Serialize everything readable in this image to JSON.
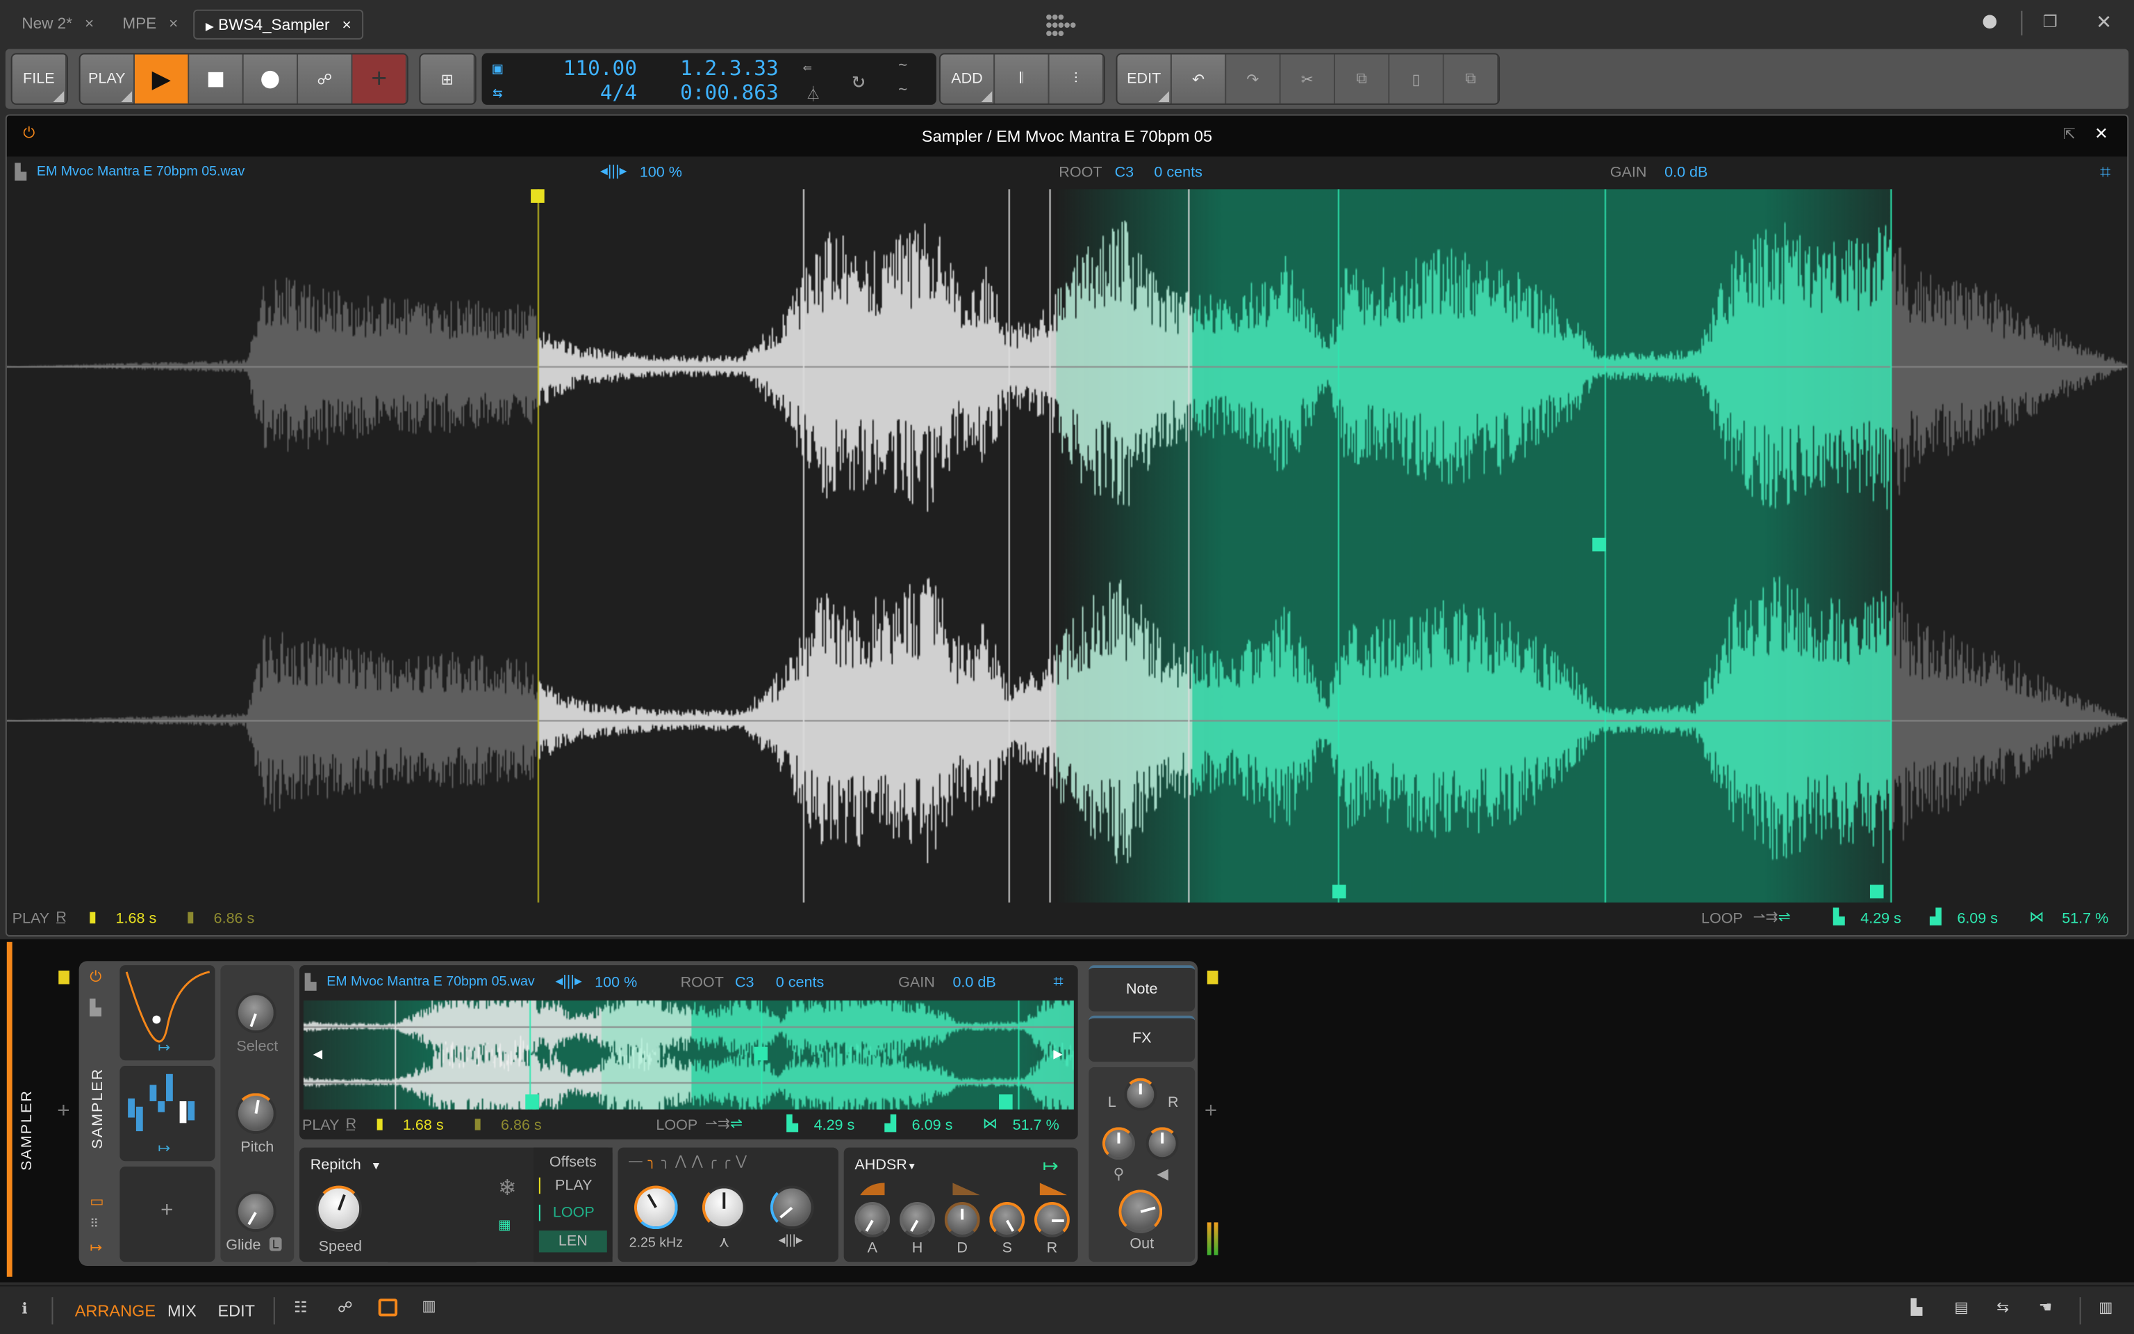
{
  "tabs": [
    {
      "label": "New 2*"
    },
    {
      "label": "MPE"
    },
    {
      "label": "BWS4_Sampler",
      "active": true
    }
  ],
  "tab_close": "×",
  "toolbar": {
    "file": "FILE",
    "play": "PLAY",
    "add": "ADD",
    "edit": "EDIT",
    "tempo": "110.00",
    "signature": "4/4",
    "position": "1.2.3.33",
    "time": "0:00.863"
  },
  "editor": {
    "title": "Sampler / EM Mvoc Mantra E 70bpm 05",
    "filename": "EM Mvoc Mantra E 70bpm 05.wav",
    "speed": "100 %",
    "root_label": "ROOT",
    "root": "C3",
    "cents": "0 cents",
    "gain_label": "GAIN",
    "gain": "0.0 dB",
    "play_label": "PLAY",
    "play_start": "1.68 s",
    "play_end": "6.86 s",
    "loop_label": "LOOP",
    "loop_start": "4.29 s",
    "loop_len": "6.09 s",
    "crossfade": "51.7 %"
  },
  "device": {
    "track_label": "SAMPLER",
    "device_label": "SAMPLER",
    "select": "Select",
    "pitch": "Pitch",
    "glide": "Glide",
    "glide_badge": "L",
    "add": "+",
    "filename": "EM Mvoc Mantra E 70bpm 05.wav",
    "speed": "100 %",
    "root_label": "ROOT",
    "root": "C3",
    "cents": "0 cents",
    "gain_label": "GAIN",
    "gain": "0.0 dB",
    "play_label": "PLAY",
    "play_start": "1.68 s",
    "play_end": "6.86 s",
    "loop_label": "LOOP",
    "loop_start": "4.29 s",
    "loop_len": "6.09 s",
    "crossfade": "51.7 %",
    "mode": "Repitch",
    "speed_knob": "Speed",
    "offsets": "Offsets",
    "off_play": "PLAY",
    "off_loop": "LOOP",
    "off_len": "LEN",
    "filter_freq": "2.25 kHz",
    "env": "AHDSR",
    "env_labels": [
      "A",
      "H",
      "D",
      "S",
      "R"
    ],
    "note": "Note",
    "fx": "FX",
    "pan_l": "L",
    "pan_r": "R",
    "out": "Out",
    "add_right": "+"
  },
  "bottom": {
    "arrange": "ARRANGE",
    "mix": "MIX",
    "edit": "EDIT"
  },
  "colors": {
    "accent": "#ff8c1a",
    "loop": "#2ee8b0",
    "play_marker": "#e8e020",
    "value_blue": "#3fb3ff"
  }
}
